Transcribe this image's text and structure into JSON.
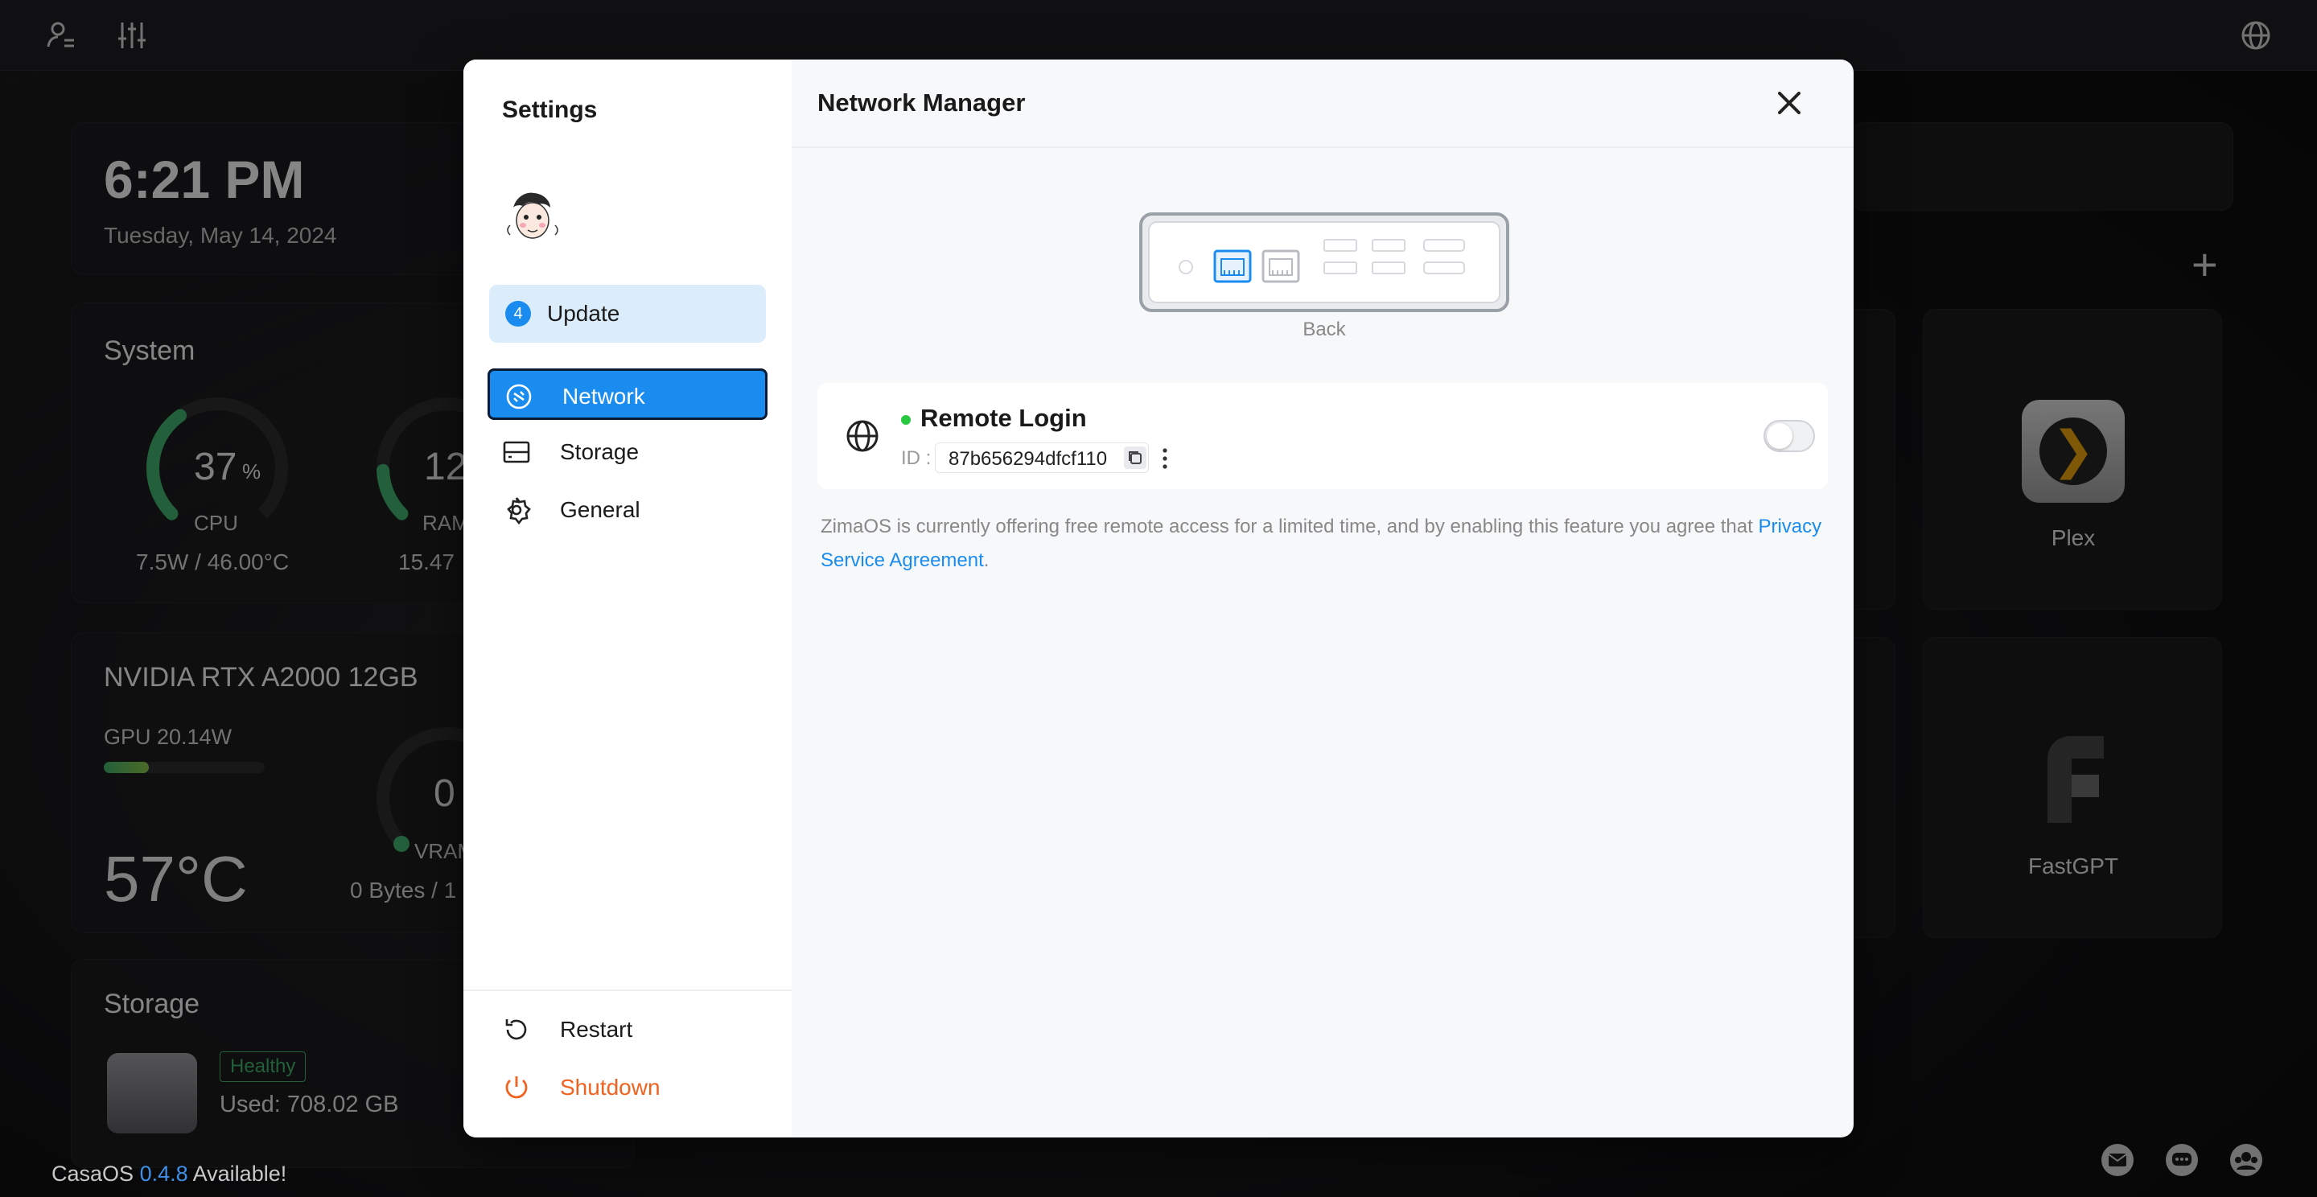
{
  "desktop": {
    "clock": {
      "time": "6:21 PM",
      "date": "Tuesday, May 14, 2024"
    },
    "system": {
      "title": "System",
      "cpu": {
        "percent": "37",
        "unit": "%",
        "label": "CPU",
        "detail": "7.5W / 46.00°C",
        "fill": 0.37
      },
      "ram": {
        "percent": "12",
        "label": "RAM",
        "detail": "15.47"
      }
    },
    "gpu": {
      "title": "NVIDIA RTX A2000 12GB",
      "power": "GPU 20.14W",
      "power_fill": 0.28,
      "temp": "57°C",
      "vram_value": "0",
      "vram_label": "VRAM",
      "vram_detail": "0 Bytes / 1"
    },
    "storage": {
      "title": "Storage",
      "badge": "Healthy",
      "used": "Used: 708.02 GB"
    },
    "apps": [
      {
        "name": "Plex"
      },
      {
        "name": "FastGPT"
      }
    ],
    "update_notice": {
      "product": "CasaOS",
      "version": "0.4.8",
      "suffix": "Available!"
    }
  },
  "settings": {
    "title": "Settings",
    "update": {
      "count": "4",
      "label": "Update"
    },
    "nav": [
      {
        "label": "Network",
        "icon": "network-icon",
        "active": true
      },
      {
        "label": "Storage",
        "icon": "storage-icon",
        "active": false
      },
      {
        "label": "General",
        "icon": "gear-icon",
        "active": false
      }
    ],
    "bottom": [
      {
        "label": "Restart",
        "icon": "restart-icon"
      },
      {
        "label": "Shutdown",
        "icon": "power-icon"
      }
    ]
  },
  "network_manager": {
    "title": "Network Manager",
    "device_label": "Back",
    "remote_login": {
      "title": "Remote Login",
      "status_color": "#28c840",
      "id_label": "ID :",
      "id_value": "87b656294dfcf110",
      "enabled": false
    },
    "notice": {
      "text": "ZimaOS is currently offering free remote access for a limited time, and by enabling this feature you agree that ",
      "link": "Privacy Service Agreement",
      "end": "."
    }
  },
  "colors": {
    "accent": "#1a8cf0",
    "danger": "#f2621f",
    "ok": "#28c840"
  }
}
